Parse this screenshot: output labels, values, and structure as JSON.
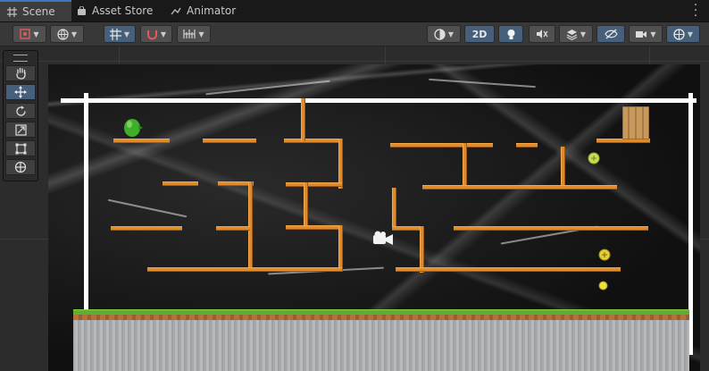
{
  "tabs": [
    {
      "label": "Scene",
      "icon": "grid-icon",
      "active": true
    },
    {
      "label": "Asset Store",
      "icon": "bag-icon",
      "active": false
    },
    {
      "label": "Animator",
      "icon": "animator-icon",
      "active": false
    }
  ],
  "toolbar": {
    "mode_2d_label": "2D"
  },
  "tools": [
    {
      "name": "hand-tool",
      "icon": "hand-icon"
    },
    {
      "name": "move-tool",
      "icon": "move-arrows-icon",
      "selected": true
    },
    {
      "name": "rotate-tool",
      "icon": "rotate-icon"
    },
    {
      "name": "scale-tool",
      "icon": "scale-icon"
    },
    {
      "name": "rect-tool",
      "icon": "rect-icon"
    },
    {
      "name": "transform-tool",
      "icon": "transform-icon"
    }
  ],
  "colors": {
    "platform": "#e08a2e",
    "accent": "#46607c",
    "grass": "#5fae2e",
    "background": "#101010"
  }
}
